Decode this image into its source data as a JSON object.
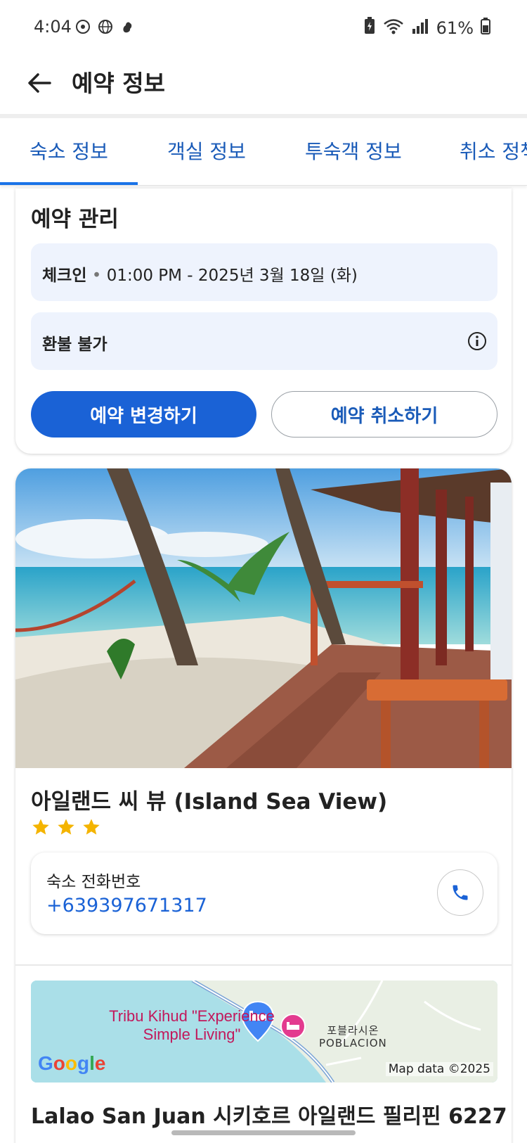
{
  "status_bar": {
    "time": "4:04",
    "battery": "61%",
    "icons": [
      "sync-icon",
      "globe-icon",
      "notification-icon",
      "battery-saver-icon",
      "wifi-icon",
      "signal-icon",
      "battery-icon"
    ]
  },
  "header": {
    "title": "예약 정보",
    "back_icon": "back-arrow-icon"
  },
  "tabs": [
    {
      "label": "숙소 정보",
      "active": true
    },
    {
      "label": "객실 정보",
      "active": false
    },
    {
      "label": "투숙객 정보",
      "active": false
    },
    {
      "label": "취소 정책",
      "active": false
    }
  ],
  "reservation": {
    "section_title": "예약 관리",
    "checkin_label": "체크인",
    "checkin_value": "01:00 PM - 2025년 3월 18일 (화)",
    "refund_text": "환불 불가",
    "change_button": "예약 변경하기",
    "cancel_button": "예약 취소하기"
  },
  "hotel": {
    "name": "아일랜드 씨 뷰 (Island Sea View)",
    "star_rating": 3,
    "phone_label": "숙소 전화번호",
    "phone_number": "+639397671317",
    "map": {
      "place_label": "Tribu Kihud \"Experience Simple Living\"",
      "area_label_ko": "포블라시온",
      "area_label_en": "POBLACION",
      "logo": "Google",
      "attribution": "Map data ©2025"
    },
    "address": "Lalao San Juan 시키호르 아일랜드 필리핀 6227"
  },
  "colors": {
    "accent": "#1a62d6",
    "tab_text": "#1a5bb8",
    "info_bg": "#eef3fd",
    "star": "#f4b400"
  }
}
